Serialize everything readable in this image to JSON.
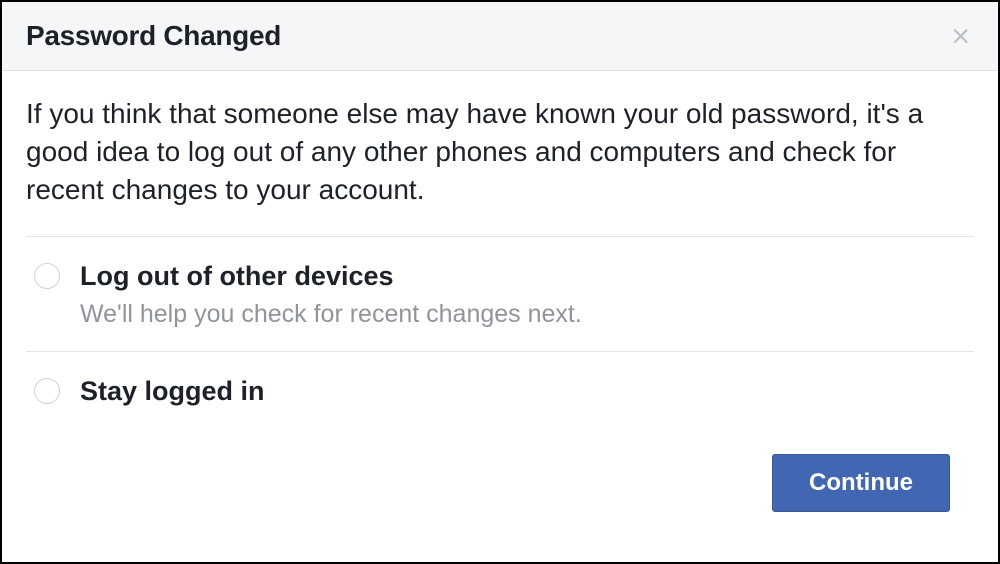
{
  "header": {
    "title": "Password Changed"
  },
  "body": {
    "description": "If you think that someone else may have known your old password, it's a good idea to log out of any other phones and computers and check for recent changes to your account."
  },
  "options": [
    {
      "label": "Log out of other devices",
      "sublabel": "We'll help you check for recent changes next."
    },
    {
      "label": "Stay logged in",
      "sublabel": ""
    }
  ],
  "footer": {
    "continue_label": "Continue"
  }
}
